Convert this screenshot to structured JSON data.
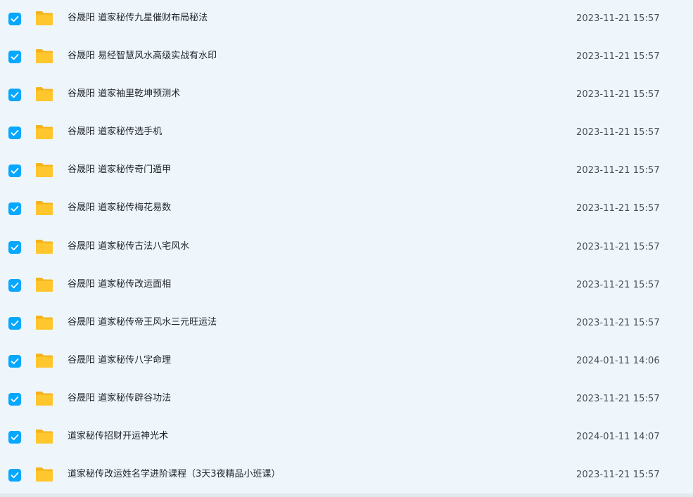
{
  "files": [
    {
      "name": "谷晟阳 道家秘传九星催财布局秘法",
      "modified": "2023-11-21 15:57"
    },
    {
      "name": "谷晟阳 易经智慧风水高级实战有水印",
      "modified": "2023-11-21 15:57"
    },
    {
      "name": "谷晟阳 道家袖里乾坤预测术",
      "modified": "2023-11-21 15:57"
    },
    {
      "name": "谷晟阳 道家秘传选手机",
      "modified": "2023-11-21 15:57"
    },
    {
      "name": "谷晟阳 道家秘传奇门遁甲",
      "modified": "2023-11-21 15:57"
    },
    {
      "name": "谷晟阳 道家秘传梅花易数",
      "modified": "2023-11-21 15:57"
    },
    {
      "name": "谷晟阳 道家秘传古法八宅风水",
      "modified": "2023-11-21 15:57"
    },
    {
      "name": "谷晟阳 道家秘传改运面相",
      "modified": "2023-11-21 15:57"
    },
    {
      "name": "谷晟阳 道家秘传帝王风水三元旺运法",
      "modified": "2023-11-21 15:57"
    },
    {
      "name": "谷晟阳 道家秘传八字命理",
      "modified": "2024-01-11 14:06"
    },
    {
      "name": "谷晟阳 道家秘传辟谷功法",
      "modified": "2023-11-21 15:57"
    },
    {
      "name": "道家秘传招财开运神光术",
      "modified": "2024-01-11 14:07"
    },
    {
      "name": "道家秘传改运姓名学进阶课程（3天3夜精品小班课）",
      "modified": "2023-11-21 15:57"
    }
  ],
  "icons": {
    "checkbox": "checkbox-checked-icon",
    "folder": "folder-icon"
  },
  "colors": {
    "background": "#eef6fc",
    "checkbox": "#06a7ff",
    "folder": "#ffc62e",
    "text": "#1f2329",
    "date": "#4a4f57"
  }
}
